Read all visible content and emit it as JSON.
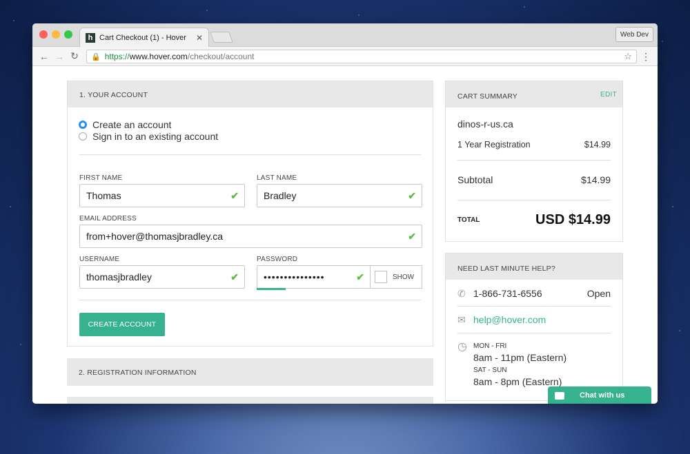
{
  "browser": {
    "tab_title": "Cart Checkout (1) - Hover",
    "favicon_letter": "h",
    "profile": "Web Dev",
    "url_https": "https://",
    "url_domain": "www.hover.com",
    "url_path": "/checkout/account"
  },
  "account": {
    "heading": "1. YOUR ACCOUNT",
    "option_create": "Create an account",
    "option_signin": "Sign in to an existing account",
    "first_name_label": "FIRST NAME",
    "first_name": "Thomas",
    "last_name_label": "LAST NAME",
    "last_name": "Bradley",
    "email_label": "EMAIL ADDRESS",
    "email": "from+hover@thomasjbradley.ca",
    "username_label": "USERNAME",
    "username": "thomasjbradley",
    "password_label": "PASSWORD",
    "password_masked": "•••••••••••••••",
    "show_label": "SHOW",
    "create_button": "CREATE ACCOUNT"
  },
  "registration": {
    "heading": "2. REGISTRATION INFORMATION"
  },
  "cart": {
    "heading": "CART SUMMARY",
    "edit": "EDIT",
    "domain": "dinos-r-us.ca",
    "item_label": "1 Year Registration",
    "item_price": "$14.99",
    "subtotal_label": "Subtotal",
    "subtotal": "$14.99",
    "total_label": "TOTAL",
    "total": "USD $14.99"
  },
  "help": {
    "heading": "NEED LAST MINUTE HELP?",
    "phone": "1-866-731-6556",
    "phone_status": "Open",
    "email": "help@hover.com",
    "weekday_label": "MON - FRI",
    "weekday_hours": "8am - 11pm (Eastern)",
    "weekend_label": "SAT - SUN",
    "weekend_hours": "8am - 8pm (Eastern)"
  },
  "chat": {
    "label": "Chat with us"
  },
  "colors": {
    "accent": "#37b28f",
    "radio": "#2d8fe2",
    "check": "#5dbb46"
  }
}
